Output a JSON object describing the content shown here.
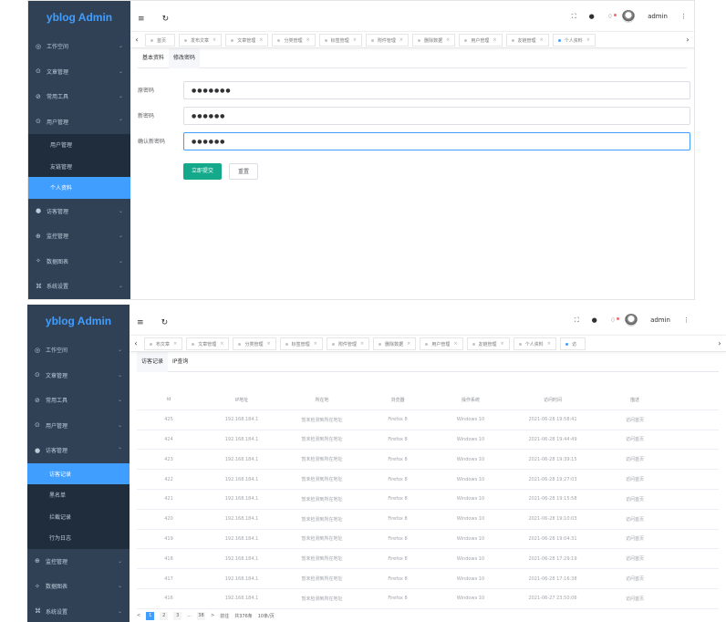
{
  "p1": {
    "logo": "yblog Admin",
    "sidebar": [
      {
        "icon": "dashboard-icon",
        "glyph": "◎",
        "label": "工作空间",
        "chev": "⌄"
      },
      {
        "icon": "article-icon",
        "glyph": "⊙",
        "label": "文章管理",
        "chev": "⌄"
      },
      {
        "icon": "tool-icon",
        "glyph": "⊘",
        "label": "常用工具",
        "chev": "⌄"
      },
      {
        "icon": "user-icon",
        "glyph": "⊙",
        "label": "用户管理",
        "chev": "⌃"
      }
    ],
    "sub": [
      {
        "label": "用户管理",
        "active": false
      },
      {
        "label": "友链管理",
        "active": false
      },
      {
        "label": "个人资料",
        "active": true
      }
    ],
    "sidebar_after": [
      {
        "icon": "visitor-icon",
        "glyph": "●",
        "label": "访客管理",
        "chev": "⌄"
      },
      {
        "icon": "monitor-icon",
        "glyph": "⊕",
        "label": "监控管理",
        "chev": "⌄"
      },
      {
        "icon": "chart-icon",
        "glyph": "✧",
        "label": "数据图表",
        "chev": "⌄"
      },
      {
        "icon": "settings-icon",
        "glyph": "⌘",
        "label": "系统设置",
        "chev": "⌄"
      }
    ],
    "tags": [
      {
        "label": "首页",
        "active": false,
        "close": ""
      },
      {
        "label": "发布文章",
        "active": false,
        "close": "×"
      },
      {
        "label": "文章管理",
        "active": false,
        "close": "×"
      },
      {
        "label": "分类管理",
        "active": false,
        "close": "×"
      },
      {
        "label": "标签管理",
        "active": false,
        "close": "×"
      },
      {
        "label": "附件管理",
        "active": false,
        "close": "×"
      },
      {
        "label": "删除数据",
        "active": false,
        "close": "×"
      },
      {
        "label": "用户管理",
        "active": false,
        "close": "×"
      },
      {
        "label": "友链管理",
        "active": false,
        "close": "×"
      },
      {
        "label": "个人资料",
        "active": true,
        "close": "×"
      }
    ],
    "tabs": [
      "基本资料",
      "修改密码"
    ],
    "form": [
      {
        "label": "原密码",
        "value": "●●●●●●●",
        "focus": false
      },
      {
        "label": "新密码",
        "value": "●●●●●●",
        "focus": false
      },
      {
        "label": "确认新密码",
        "value": "●●●●●●",
        "focus": true
      }
    ],
    "submit": "立即提交",
    "reset": "重置"
  },
  "p2": {
    "logo": "yblog Admin",
    "sidebar": [
      {
        "icon": "dashboard-icon",
        "glyph": "◎",
        "label": "工作空间",
        "chev": "⌄"
      },
      {
        "icon": "article-icon",
        "glyph": "⊙",
        "label": "文章管理",
        "chev": "⌄"
      },
      {
        "icon": "tool-icon",
        "glyph": "⊘",
        "label": "常用工具",
        "chev": "⌄"
      },
      {
        "icon": "user-icon",
        "glyph": "⊙",
        "label": "用户管理",
        "chev": "⌄"
      },
      {
        "icon": "visitor-icon",
        "glyph": "●",
        "label": "访客管理",
        "chev": "⌃"
      }
    ],
    "sub": [
      {
        "label": "访客记录",
        "active": true
      },
      {
        "label": "黑名单",
        "active": false
      },
      {
        "label": "拦截记录",
        "active": false
      },
      {
        "label": "行为日志",
        "active": false
      }
    ],
    "sidebar_after": [
      {
        "icon": "monitor-icon",
        "glyph": "⊕",
        "label": "监控管理",
        "chev": "⌄"
      },
      {
        "icon": "chart-icon",
        "glyph": "✧",
        "label": "数据图表",
        "chev": "⌄"
      },
      {
        "icon": "settings-icon",
        "glyph": "⌘",
        "label": "系统设置",
        "chev": "⌄"
      }
    ],
    "tags": [
      {
        "label": "布文章",
        "active": false,
        "close": "×"
      },
      {
        "label": "文章管理",
        "active": false,
        "close": "×"
      },
      {
        "label": "分类管理",
        "active": false,
        "close": "×"
      },
      {
        "label": "标签管理",
        "active": false,
        "close": "×"
      },
      {
        "label": "附件管理",
        "active": false,
        "close": "×"
      },
      {
        "label": "删除数据",
        "active": false,
        "close": "×"
      },
      {
        "label": "用户管理",
        "active": false,
        "close": "×"
      },
      {
        "label": "友链管理",
        "active": false,
        "close": "×"
      },
      {
        "label": "个人资料",
        "active": false,
        "close": "×"
      },
      {
        "label": "访",
        "active": true,
        "close": ""
      }
    ],
    "tabs": [
      "访客记录",
      "IP查询"
    ],
    "headers": [
      "id",
      "IP地址",
      "所在地",
      "浏览器",
      "操作系统",
      "访问时间",
      "描述"
    ],
    "rows": [
      [
        "425",
        "192.168.184.1",
        "暂未检测到所在地址",
        "Firefox 8",
        "Windows 10",
        "2021-06-28 19:58:41",
        "访问首页"
      ],
      [
        "424",
        "192.168.184.1",
        "暂未检测到所在地址",
        "Firefox 8",
        "Windows 10",
        "2021-06-28 19:44:49",
        "访问首页"
      ],
      [
        "423",
        "192.168.184.1",
        "暂未检测到所在地址",
        "Firefox 8",
        "Windows 10",
        "2021-06-28 19:39:15",
        "访问首页"
      ],
      [
        "422",
        "192.168.184.1",
        "暂未检测到所在地址",
        "Firefox 8",
        "Windows 10",
        "2021-06-28 19:27:03",
        "访问首页"
      ],
      [
        "421",
        "192.168.184.1",
        "暂未检测到所在地址",
        "Firefox 8",
        "Windows 10",
        "2021-06-28 19:15:58",
        "访问首页"
      ],
      [
        "420",
        "192.168.184.1",
        "暂未检测到所在地址",
        "Firefox 8",
        "Windows 10",
        "2021-06-28 19:10:03",
        "访问首页"
      ],
      [
        "419",
        "192.168.184.1",
        "暂未检测到所在地址",
        "Firefox 8",
        "Windows 10",
        "2021-06-28 19:04:31",
        "访问首页"
      ],
      [
        "418",
        "192.168.184.1",
        "暂未检测到所在地址",
        "Firefox 8",
        "Windows 10",
        "2021-06-28 17:29:19",
        "访问首页"
      ],
      [
        "417",
        "192.168.184.1",
        "暂未检测到所在地址",
        "Firefox 8",
        "Windows 10",
        "2021-06-28 17:16:38",
        "访问首页"
      ],
      [
        "416",
        "192.168.184.1",
        "暂未检测到所在地址",
        "Firefox 8",
        "Windows 10",
        "2021-06-27 23:50:06",
        "访问首页"
      ]
    ],
    "pager": [
      {
        "text": "<",
        "kind": "nav"
      },
      {
        "text": "1",
        "kind": "on"
      },
      {
        "text": "2",
        "kind": "pg"
      },
      {
        "text": "3",
        "kind": "pg"
      },
      {
        "text": "...",
        "kind": "txt"
      },
      {
        "text": "38",
        "kind": "pg"
      },
      {
        "text": ">",
        "kind": "nav"
      },
      {
        "text": "前往",
        "kind": "txt"
      },
      {
        "text": "共376条",
        "kind": "txt"
      },
      {
        "text": "10条/页",
        "kind": "txt"
      }
    ]
  },
  "navbar": {
    "menu_glyph": "≡",
    "refresh_glyph": "↻",
    "full_glyph": "⛶",
    "theme_glyph": "●",
    "bell_glyph": "🔔",
    "user": "admin",
    "more_glyph": "⋮",
    "left_arrow": "‹",
    "right_arrow": "›"
  }
}
